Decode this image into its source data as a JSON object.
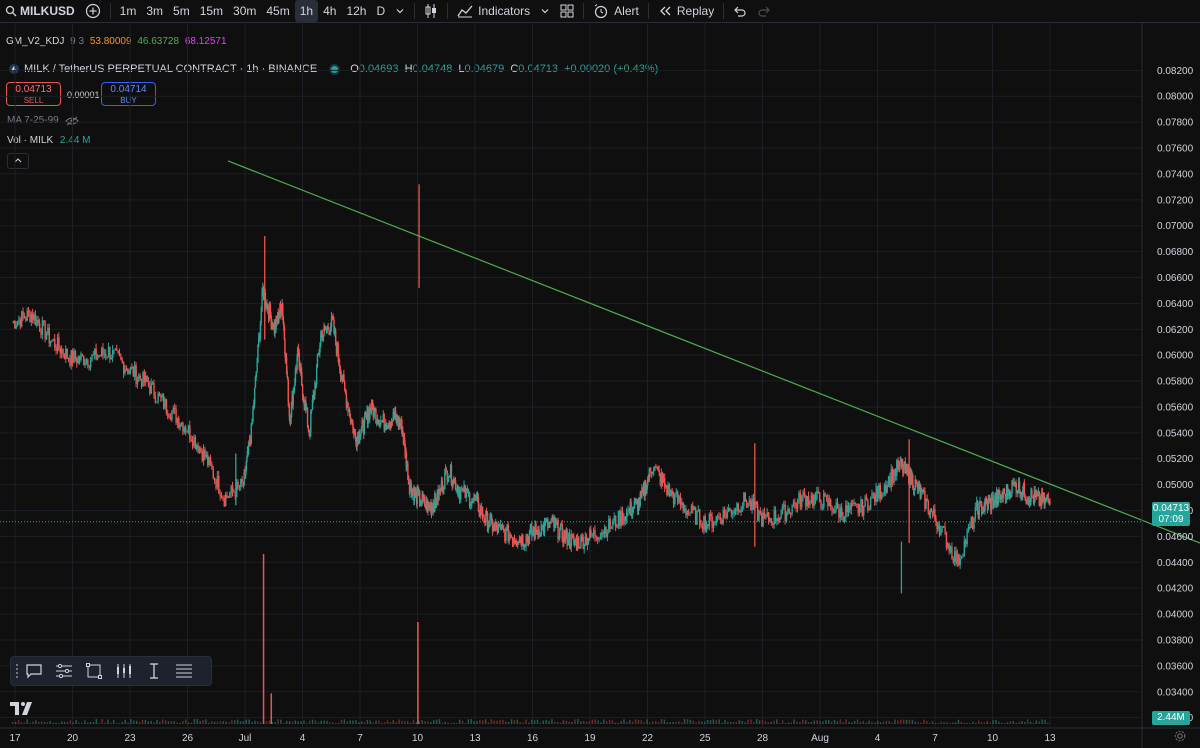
{
  "toolbar": {
    "symbol": "MILKUSD",
    "timeframes": [
      "1m",
      "3m",
      "5m",
      "15m",
      "30m",
      "45m",
      "1h",
      "4h",
      "12h",
      "D"
    ],
    "active_timeframe": "1h",
    "indicators_label": "Indicators",
    "alert_label": "Alert",
    "replay_label": "Replay"
  },
  "indicator": {
    "name": "GM_V2_KDJ",
    "params": "9 3",
    "v1": "53.80009",
    "v2": "46.63728",
    "v3": "68.12571",
    "colors": {
      "v1": "#ff9800",
      "v2": "#4caf50",
      "v3": "#e040fb"
    }
  },
  "legend": {
    "title": "MILK / TetherUS PERPETUAL CONTRACT · 1h · BINANCE",
    "o_label": "O",
    "o": "0.04693",
    "h_label": "H",
    "h": "0.04748",
    "l_label": "L",
    "l": "0.04679",
    "c_label": "C",
    "c": "0.04713",
    "change": "+0.00020 (+0.43%)"
  },
  "trade": {
    "sell_price": "0.04713",
    "sell_label": "SELL",
    "spread": "0.00001",
    "buy_price": "0.04714",
    "buy_label": "BUY"
  },
  "ma_label": "MA 7-25-99",
  "volume": {
    "label": "Vol · MILK",
    "value": "2.44 M",
    "axis_tag": "2.44M"
  },
  "last_price": {
    "price": "0.04713",
    "countdown": "07:09"
  },
  "chart_data": {
    "type": "line",
    "title": "MILK / TetherUS PERPETUAL CONTRACT · 1h · BINANCE",
    "ylim": [
      0.0312,
      0.0828
    ],
    "y_ticks": [
      "0.08200",
      "0.08000",
      "0.07800",
      "0.07600",
      "0.07400",
      "0.07200",
      "0.07000",
      "0.06800",
      "0.06600",
      "0.06400",
      "0.06200",
      "0.06000",
      "0.05800",
      "0.05600",
      "0.05400",
      "0.05200",
      "0.05000",
      "0.04800",
      "0.04600",
      "0.04400",
      "0.04200",
      "0.04000",
      "0.03800",
      "0.03600",
      "0.03400",
      "0.03200"
    ],
    "x_ticks": [
      "17",
      "20",
      "23",
      "26",
      "Jul",
      "4",
      "7",
      "10",
      "13",
      "16",
      "19",
      "22",
      "25",
      "28",
      "Aug",
      "4",
      "7",
      "10",
      "13"
    ],
    "x_range_days": [
      17.0,
      43.9
    ],
    "series": [
      {
        "x": [
          17.0,
          17.5,
          18.0,
          18.5,
          19.0,
          19.5,
          20.0,
          20.5,
          21.0,
          21.5,
          22.0,
          22.5,
          23.0,
          23.2,
          23.5,
          23.8,
          24.0,
          24.2,
          24.4,
          24.7,
          25.0,
          25.3,
          25.6,
          25.9,
          26.1,
          26.3,
          26.6,
          26.9,
          27.1,
          27.3,
          27.5,
          27.8,
          28.0,
          28.3,
          28.6,
          29.0,
          29.3,
          29.6,
          30.0,
          30.3,
          30.6,
          31.0,
          31.3,
          31.6,
          32.0,
          32.5,
          33.0,
          33.3,
          33.6,
          34.0,
          34.5,
          35.0,
          35.5,
          36.0,
          36.5,
          37.0,
          37.5,
          38.0,
          38.5,
          39.0,
          39.5,
          40.0,
          40.3,
          40.6,
          41.0,
          41.5,
          42.0,
          42.3,
          42.6,
          43.0,
          43.3,
          43.6,
          43.9
        ],
        "close": [
          0.0625,
          0.0632,
          0.0612,
          0.0598,
          0.0597,
          0.0603,
          0.059,
          0.0578,
          0.056,
          0.0545,
          0.0522,
          0.049,
          0.05,
          0.054,
          0.065,
          0.062,
          0.064,
          0.055,
          0.06,
          0.054,
          0.0615,
          0.0625,
          0.0575,
          0.0535,
          0.0545,
          0.056,
          0.0548,
          0.0552,
          0.0545,
          0.05,
          0.049,
          0.0482,
          0.0488,
          0.0512,
          0.0495,
          0.0488,
          0.0472,
          0.0465,
          0.046,
          0.0458,
          0.0465,
          0.047,
          0.046,
          0.0455,
          0.046,
          0.0468,
          0.048,
          0.0488,
          0.0515,
          0.0495,
          0.048,
          0.047,
          0.0478,
          0.0488,
          0.0472,
          0.0478,
          0.049,
          0.0488,
          0.0478,
          0.0482,
          0.0495,
          0.0515,
          0.0505,
          0.049,
          0.047,
          0.044,
          0.048,
          0.0485,
          0.049,
          0.05,
          0.0492,
          0.0488,
          0.0486
        ],
        "high_spikes": [
          {
            "x": 23.55,
            "y": 0.0692
          },
          {
            "x": 27.55,
            "y": 0.0732
          },
          {
            "x": 40.25,
            "y": 0.0535
          },
          {
            "x": 36.25,
            "y": 0.0532
          }
        ],
        "low_spikes": [
          {
            "x": 40.05,
            "y": 0.0416
          },
          {
            "x": 22.8,
            "y": 0.0484
          }
        ]
      }
    ],
    "trendline": {
      "x": [
        22.6,
        49.4
      ],
      "y": [
        0.075,
        0.0436
      ]
    },
    "volume_spikes": [
      {
        "x": 23.5,
        "v": 100
      },
      {
        "x": 27.5,
        "v": 60
      },
      {
        "x": 23.7,
        "v": 18
      }
    ]
  }
}
